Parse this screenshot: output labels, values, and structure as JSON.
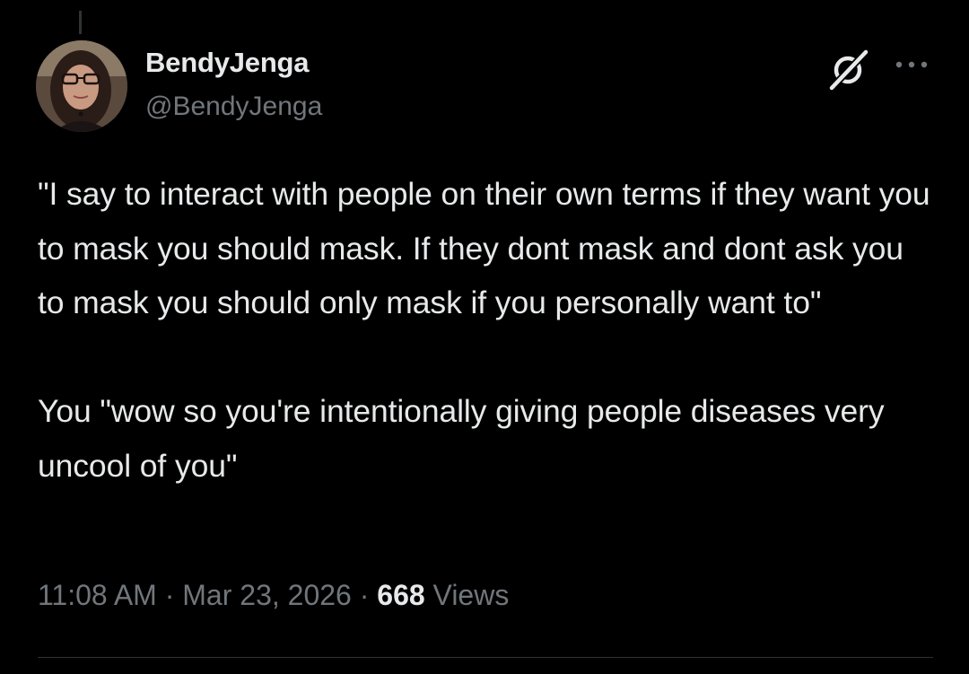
{
  "author": {
    "display_name": "BendyJenga",
    "handle": "@BendyJenga"
  },
  "tweet": {
    "text": "\"I say to interact with people on their own terms if they want you to mask you should mask. If they dont mask and dont ask you to mask you should only mask if you personally want to\"\n\nYou \"wow so you're intentionally giving people diseases very uncool of you\""
  },
  "meta": {
    "time": "11:08 AM",
    "separator": "·",
    "date": "Mar 23, 2026",
    "views_count": "668",
    "views_label": "Views"
  },
  "icons": {
    "grok": "grok-icon",
    "more": "more-horizontal-icon"
  },
  "colors": {
    "background": "#000000",
    "primary_text": "#e7e9ea",
    "secondary_text": "#71767b",
    "divider": "#2f3336"
  }
}
